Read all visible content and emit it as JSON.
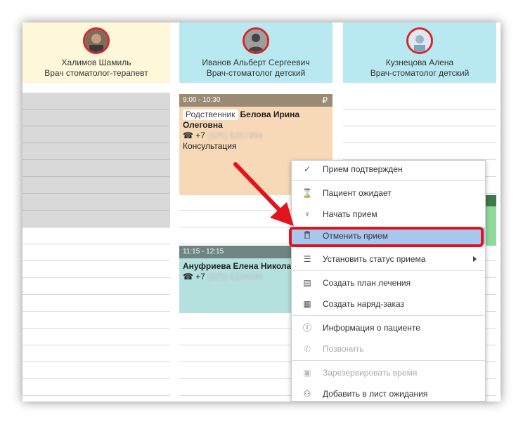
{
  "columns": [
    {
      "name": "Халимов Шамиль",
      "role": "Врач стоматолог-терапевт",
      "color": "#fff7d9"
    },
    {
      "name": "Иванов Альберт Сергеевич",
      "role": "Врач-стоматолог детский",
      "color": "#b8e9f0"
    },
    {
      "name": "Кузнецова Алена",
      "role": "Врач-стоматолог детский",
      "color": "#b8e9f0"
    }
  ],
  "appointments": [
    {
      "time": "9:00 - 10:30",
      "badge": "₽",
      "tag": "Родственник",
      "patient": "Белова Ирина Олеговна",
      "phone_prefix": "☎ +7",
      "phone_hidden": "(925) 6257999",
      "note": "Консультация",
      "header_color": "#9b8a74",
      "body_color": "#f8d9b7"
    },
    {
      "time": "11:15 - 12:15",
      "patient": "Ануфриева Елена Никола",
      "phone_prefix": "☎ +7",
      "phone_hidden": "(925) 5234689",
      "header_color": "#6e8581",
      "body_color": "#b4e0de"
    }
  ],
  "menu": {
    "items": [
      {
        "label": "Прием подтвержден",
        "icon": "check-circle-icon",
        "glyph": "✓"
      },
      {
        "label": "Пациент ожидает",
        "icon": "hourglass-icon",
        "glyph": "⌛"
      },
      {
        "label": "Начать прием",
        "icon": "stethoscope-icon",
        "glyph": "♆"
      },
      {
        "label": "Отменить прием",
        "icon": "trash-icon",
        "glyph": "🗑"
      },
      {
        "label": "Установить статус приема",
        "icon": "list-icon",
        "glyph": "☰"
      },
      {
        "label": "Создать план лечения",
        "icon": "plan-icon",
        "glyph": "▤"
      },
      {
        "label": "Создать наряд-заказ",
        "icon": "order-icon",
        "glyph": "▦"
      },
      {
        "label": "Информация о пациенте",
        "icon": "info-icon",
        "glyph": "ⓘ"
      },
      {
        "label": "Позвонить",
        "icon": "phone-icon",
        "glyph": "✆"
      },
      {
        "label": "Зарезервировать время",
        "icon": "calendar-icon",
        "glyph": "▣"
      },
      {
        "label": "Добавить в лист ожидания",
        "icon": "waitlist-icon",
        "glyph": "⚇"
      }
    ]
  },
  "colors": {
    "highlight": "#e1141e",
    "active_item": "#a8c7ef",
    "grey_slots": "#d9d9d9",
    "green_block": "#8fd99a",
    "green_header": "#3f7a4a"
  }
}
